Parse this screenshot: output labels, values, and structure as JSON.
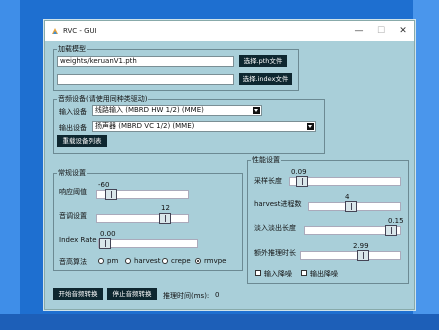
{
  "window": {
    "title": "RVC - GUI",
    "min": "—",
    "max": "☐",
    "close": "✕"
  },
  "load_model": {
    "label": "加载模型",
    "pth_value": "weights/keruanV1.pth",
    "pth_button": "选择.pth文件",
    "index_value": "",
    "index_button": "选择.index文件"
  },
  "audio_device": {
    "label": "音频设备(请使用同种类驱动)",
    "input_label": "输入设备",
    "input_value": "线路输入 (MBRD HW 1/2) (MME)",
    "output_label": "输出设备",
    "output_value": "扬声器 (MBRD VC 1/2) (MME)",
    "reload_button": "重载设备列表"
  },
  "general": {
    "label": "常规设置",
    "threshold_label": "响应阈值",
    "threshold_value": "-60",
    "threshold_fraction": 0.1,
    "pitch_label": "音调设置",
    "pitch_value": "12",
    "pitch_fraction": 0.78,
    "index_rate_label": "Index Rate",
    "index_rate_value": "0.00",
    "index_rate_fraction": 0.0,
    "pitch_algo_label": "音高算法",
    "algos": [
      "pm",
      "harvest",
      "crepe",
      "rmvpe"
    ],
    "selected_algo": "rmvpe"
  },
  "performance": {
    "label": "性能设置",
    "sample_len_label": "采样长度",
    "sample_len_value": "0.09",
    "sample_len_fraction": 0.06,
    "harvest_label": "harvest进程数",
    "harvest_value": "4",
    "harvest_fraction": 0.45,
    "fade_label": "淡入淡出长度",
    "fade_value": "0.15",
    "fade_fraction": 0.96,
    "extra_label": "额外推理时长",
    "extra_value": "2.99",
    "extra_fraction": 0.64,
    "in_denoise_label": "输入降噪",
    "out_denoise_label": "输出降噪"
  },
  "bottom": {
    "start_button": "开始音频转换",
    "stop_button": "停止音频转换",
    "infer_time_label": "推理时间(ms):",
    "infer_time_value": "0"
  }
}
